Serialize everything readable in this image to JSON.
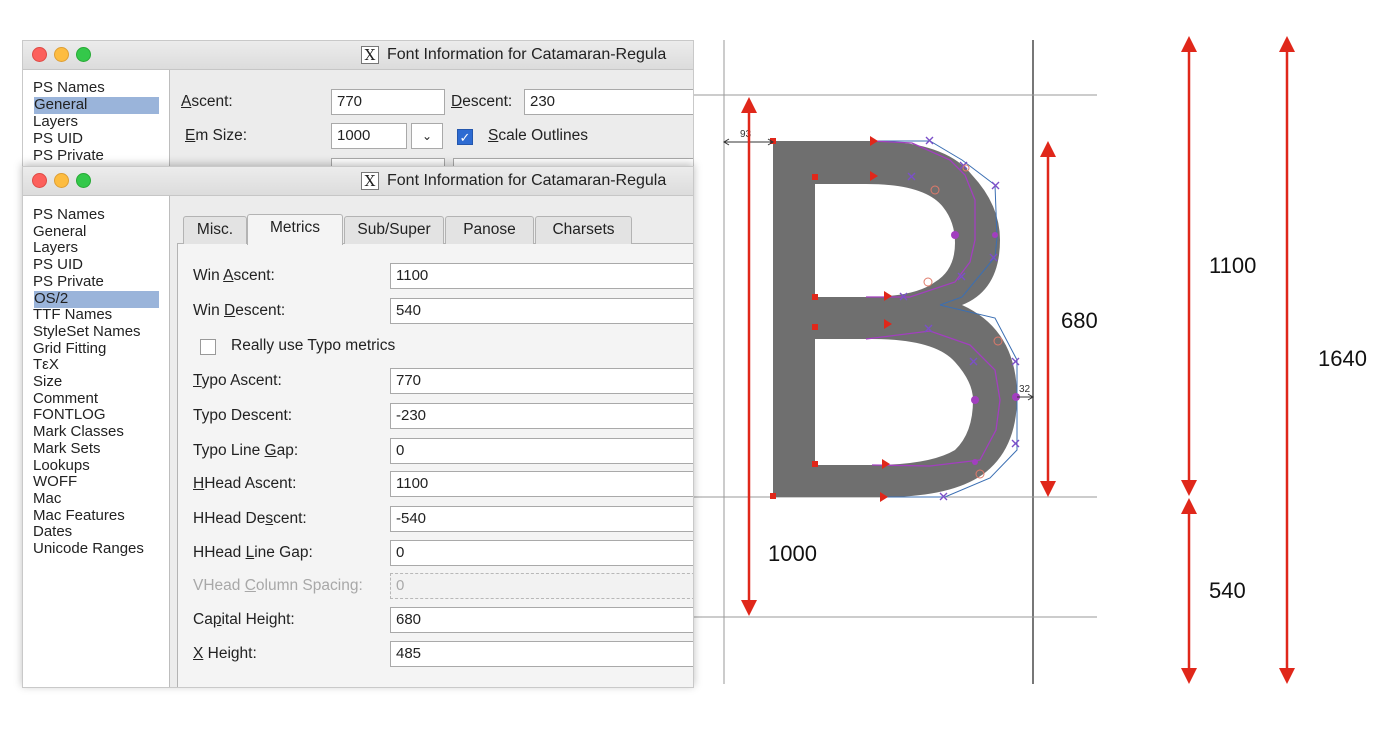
{
  "window_back": {
    "title": "Font Information for Catamaran-Regula",
    "sidebar": [
      "PS Names",
      "General",
      "Layers",
      "PS UID",
      "PS Private"
    ],
    "selected": "General",
    "ascent_label": "Ascent:",
    "ascent_value": "770",
    "descent_label": "Descent:",
    "descent_value": "230",
    "em_size_label": "Em Size:",
    "em_size_value": "1000",
    "scale_outlines_label": "Scale Outlines",
    "scale_outlines_checked": true
  },
  "window_front": {
    "title": "Font Information for Catamaran-Regula",
    "sidebar": [
      "PS Names",
      "General",
      "Layers",
      "PS UID",
      "PS Private",
      "OS/2",
      "TTF Names",
      "StyleSet Names",
      "Grid Fitting",
      "TεX",
      "Size",
      "Comment",
      "FONTLOG",
      "Mark Classes",
      "Mark Sets",
      "Lookups",
      "WOFF",
      "Mac",
      "Mac Features",
      "Dates",
      "Unicode Ranges"
    ],
    "selected": "OS/2",
    "tabs": [
      "Misc.",
      "Metrics",
      "Sub/Super",
      "Panose",
      "Charsets"
    ],
    "active_tab": "Metrics",
    "fields": [
      {
        "label": "Win Ascent:",
        "value": "1100"
      },
      {
        "label": "Win Descent:",
        "value": "540"
      },
      {
        "label": "Typo Ascent:",
        "value": "770"
      },
      {
        "label": "Typo Descent:",
        "value": "-230"
      },
      {
        "label": "Typo Line Gap:",
        "value": "0"
      },
      {
        "label": "HHead Ascent:",
        "value": "1100"
      },
      {
        "label": "HHead Descent:",
        "value": "-540"
      },
      {
        "label": "HHead Line Gap:",
        "value": "0"
      },
      {
        "label": "VHead Column Spacing:",
        "value": "0"
      },
      {
        "label": "Capital Height:",
        "value": "680"
      },
      {
        "label": "X Height:",
        "value": "485"
      }
    ],
    "typo_metrics_label": "Really use Typo metrics",
    "typo_metrics_checked": false
  },
  "glyph": {
    "lsb_label": "93",
    "rsb_label": "32",
    "dimensions": {
      "em": "1000",
      "cap_height": "680",
      "win_ascent": "1100",
      "win_descent": "540",
      "total": "1640"
    }
  },
  "colors": {
    "arrow": "#e0271a",
    "glyph_fill": "#6f6f6f",
    "selection": "#9ab4da",
    "checkbox_on": "#2d6bd2"
  }
}
